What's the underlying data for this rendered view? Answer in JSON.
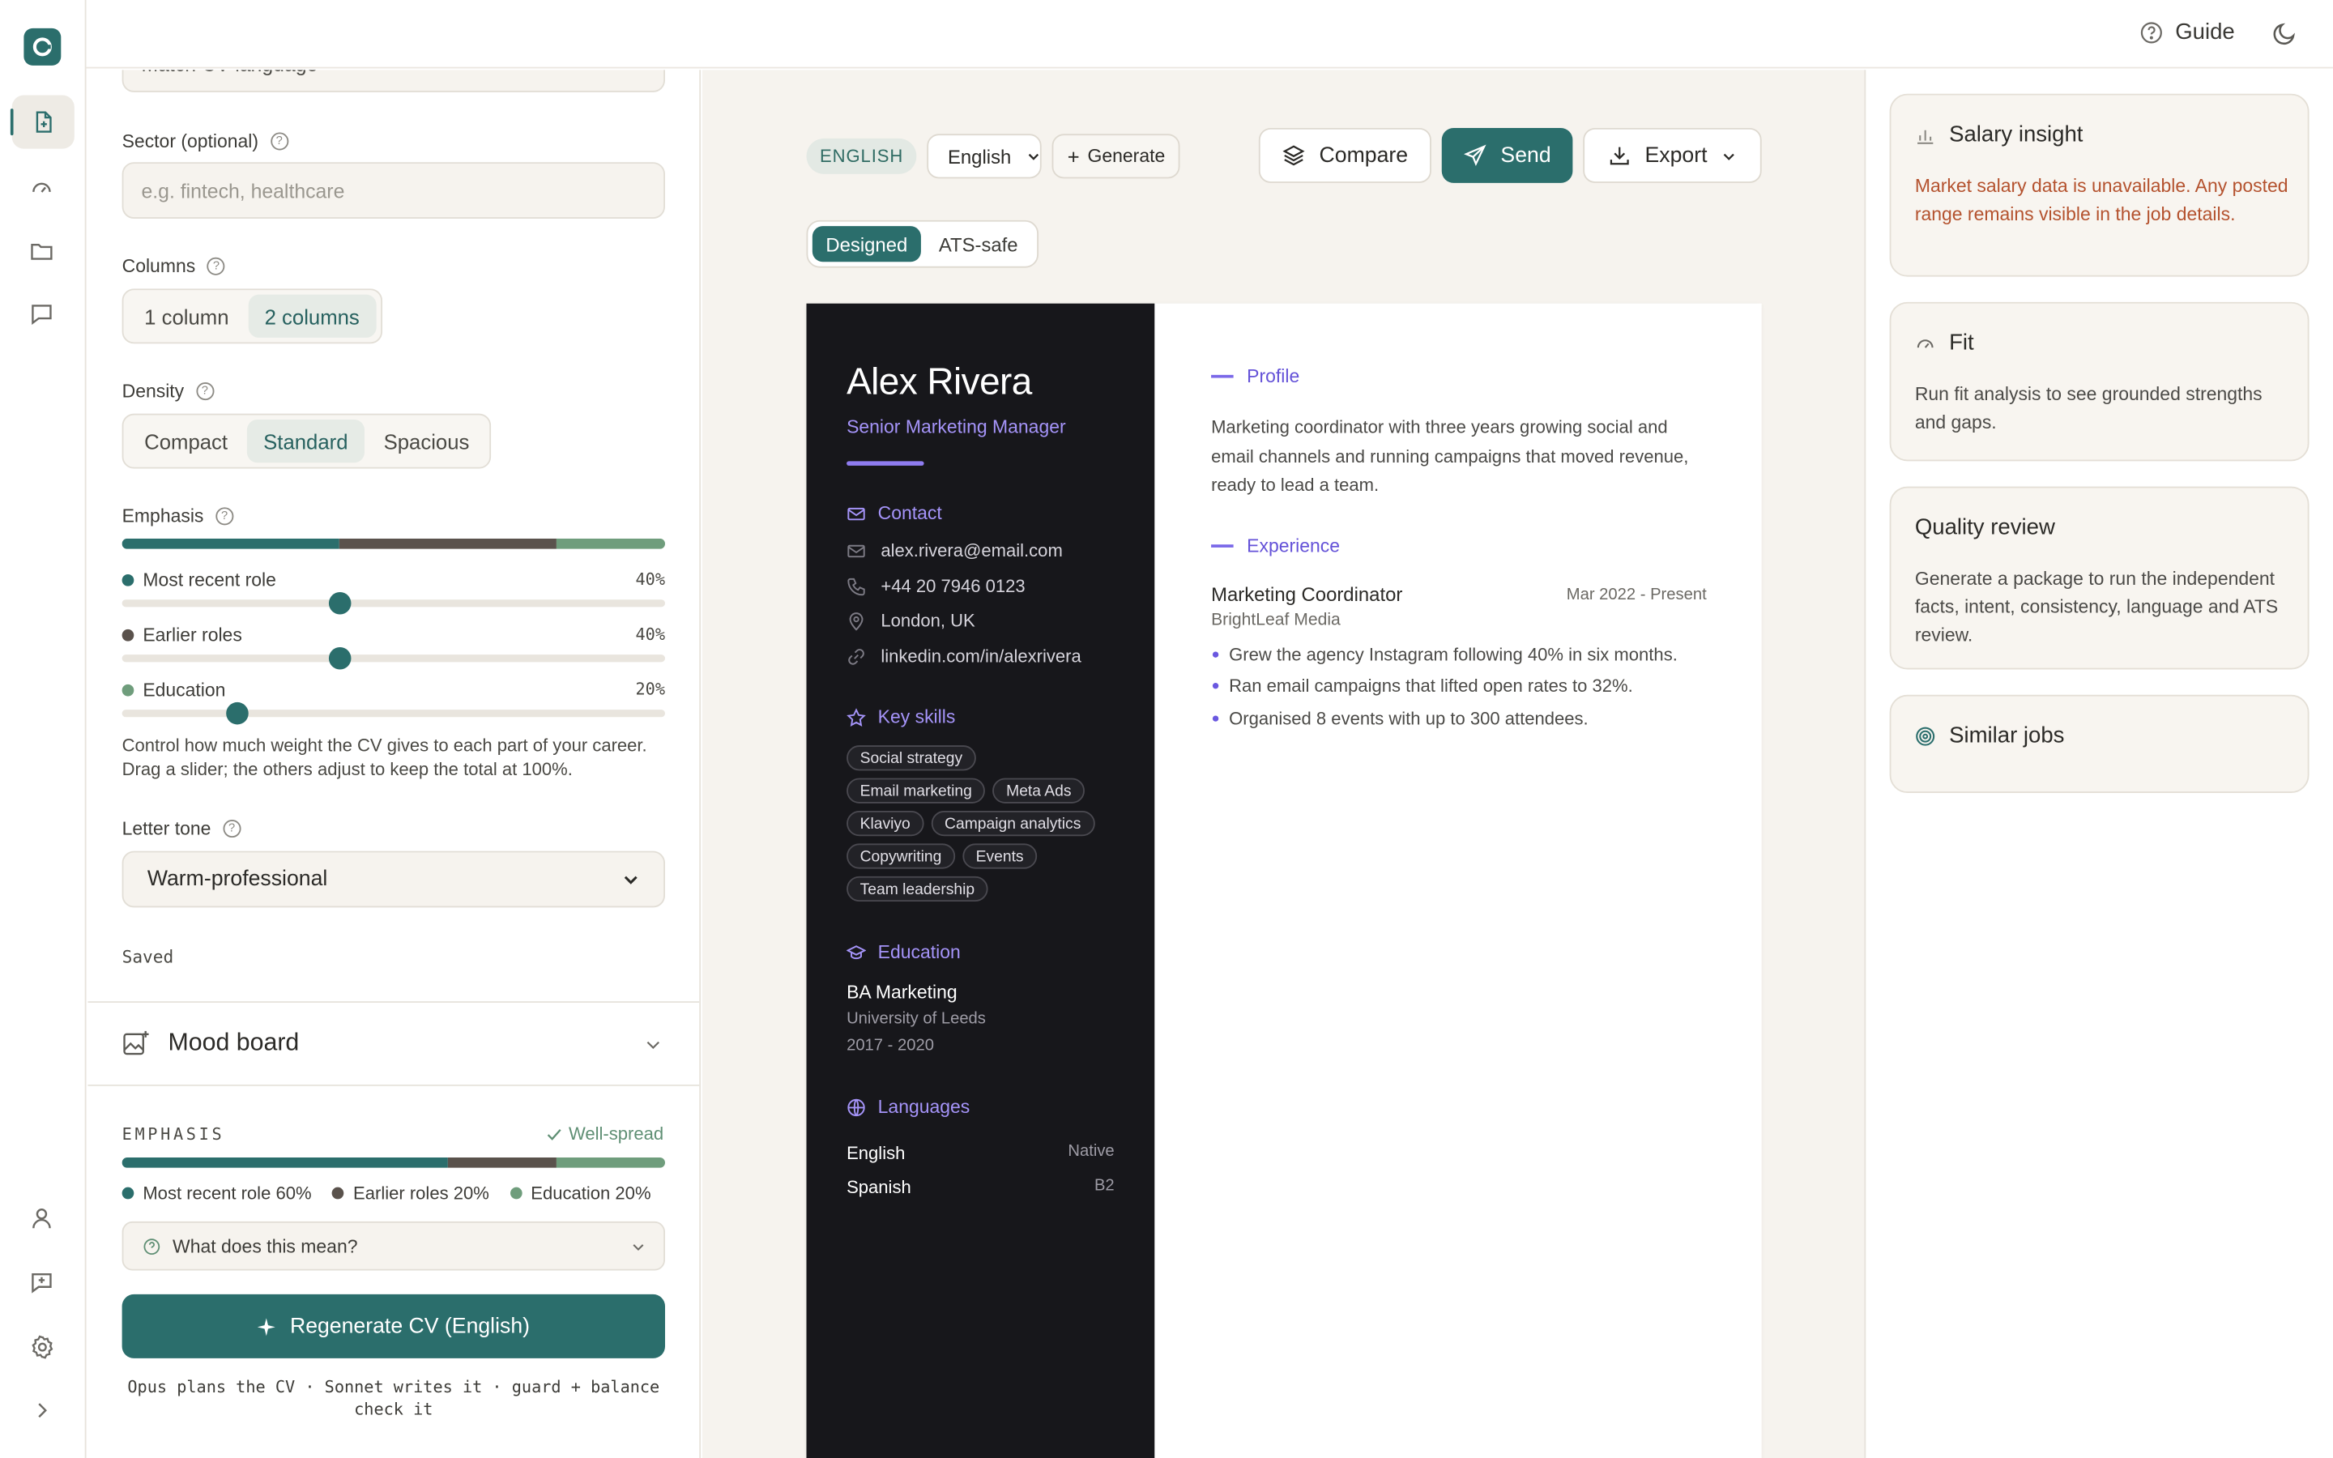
{
  "topbar": {
    "guide": "Guide"
  },
  "settings": {
    "cv_language_partial": "Match CV language",
    "sector": {
      "label": "Sector (optional)",
      "placeholder": "e.g. fintech, healthcare"
    },
    "columns": {
      "label": "Columns",
      "options": [
        "1 column",
        "2 columns"
      ],
      "selected": "2 columns"
    },
    "density": {
      "label": "Density",
      "options": [
        "Compact",
        "Standard",
        "Spacious"
      ],
      "selected": "Standard"
    },
    "emphasis": {
      "label": "Emphasis",
      "rows": [
        {
          "name": "Most recent role",
          "pct": "40%",
          "value": 0.4,
          "color": "#2b6e6c"
        },
        {
          "name": "Earlier roles",
          "pct": "40%",
          "value": 0.4,
          "color": "#5a524c"
        },
        {
          "name": "Education",
          "pct": "20%",
          "value": 0.2,
          "color": "#6f9d7c"
        }
      ],
      "help": "Control how much weight the CV gives to each part of your career. Drag a slider; the others adjust to keep the total at 100%."
    },
    "letter_tone": {
      "label": "Letter tone",
      "value": "Warm-professional"
    },
    "saved": "Saved"
  },
  "mood_board": {
    "title": "Mood board"
  },
  "emphasis_summary": {
    "heading": "EMPHASIS",
    "status": "Well-spread",
    "bar": [
      0.6,
      0.2,
      0.2
    ],
    "legend": [
      "Most recent role 60%",
      "Earlier roles 20%",
      "Education 20%"
    ],
    "what_does_this_mean": "What does this mean?",
    "regenerate": "Regenerate CV (English)",
    "footer": "Opus plans the CV · Sonnet writes it · guard + balance check it"
  },
  "toolbar": {
    "language_badge": "ENGLISH",
    "language_select": "English",
    "generate": "Generate",
    "compare": "Compare",
    "send": "Send",
    "export": "Export",
    "views": [
      "Designed",
      "ATS-safe"
    ],
    "view_selected": "Designed"
  },
  "cv": {
    "name": "Alex Rivera",
    "role": "Senior Marketing Manager",
    "contact_heading": "Contact",
    "email": "alex.rivera@email.com",
    "phone": "+44 20 7946 0123",
    "location": "London, UK",
    "linkedin": "linkedin.com/in/alexrivera",
    "skills_heading": "Key skills",
    "skills": [
      "Social strategy",
      "Email marketing",
      "Meta Ads",
      "Klaviyo",
      "Campaign analytics",
      "Copywriting",
      "Events",
      "Team leadership"
    ],
    "education_heading": "Education",
    "degree": "BA Marketing",
    "school": "University of Leeds",
    "years": "2017 - 2020",
    "languages_heading": "Languages",
    "languages": [
      {
        "lang": "English",
        "level": "Native"
      },
      {
        "lang": "Spanish",
        "level": "B2"
      }
    ],
    "profile_heading": "Profile",
    "profile": "Marketing coordinator with three years growing social and email channels and running campaigns that moved revenue, ready to lead a team.",
    "experience_heading": "Experience",
    "job_title": "Marketing Coordinator",
    "job_dates": "Mar 2022 - Present",
    "company": "BrightLeaf Media",
    "bullets": [
      "Grew the agency Instagram following 40% in six months.",
      "Ran email campaigns that lifted open rates to 32%.",
      "Organised 8 events with up to 300 attendees."
    ]
  },
  "cards": {
    "salary": {
      "title": "Salary insight",
      "body": "Market salary data is unavailable. Any posted range remains visible in the job details."
    },
    "fit": {
      "title": "Fit",
      "body": "Run fit analysis to see grounded strengths and gaps."
    },
    "quality": {
      "title": "Quality review",
      "body": "Generate a package to run the independent facts, intent, consistency, language and ATS review."
    },
    "similar": {
      "title": "Similar jobs"
    }
  },
  "colors": {
    "accent": "#2b6e6c",
    "cv_accent": "#6452d8",
    "warning": "#b4522e"
  }
}
